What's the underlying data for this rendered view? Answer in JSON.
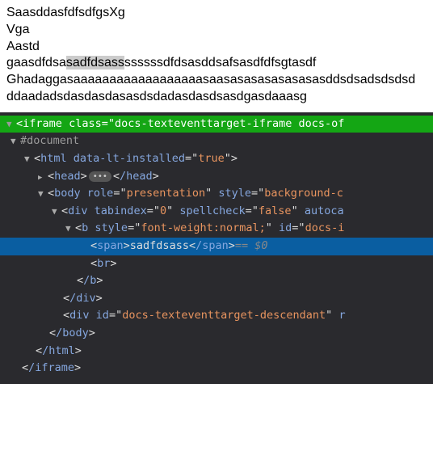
{
  "document": {
    "lines": [
      {
        "pre": "SaasddasfdfsdfgsXg",
        "sel": "",
        "post": ""
      },
      {
        "pre": "Vga",
        "sel": "",
        "post": ""
      },
      {
        "pre": "Aastd",
        "sel": "",
        "post": ""
      },
      {
        "pre": "gaasdfdsa",
        "sel": "sadfdsass",
        "post": "ssssssdfdsasddsafsasdfdfsgtasdf"
      },
      {
        "pre": "Ghadaggasaaaaaaaaaaaaaaaaaasaasasasasasasasasddsdsadsdsdsd",
        "sel": "",
        "post": ""
      },
      {
        "pre": "ddaadadsdasdasdasasdsdadasdasdsasdgasdaaasg",
        "sel": "",
        "post": ""
      }
    ]
  },
  "dom": {
    "iframe_tag": "iframe",
    "iframe_class_attr": "class",
    "iframe_class_val": "docs-texteventtarget-iframe docs-of",
    "doctype": "#document",
    "html_tag": "html",
    "html_attr": "data-lt-installed",
    "html_val": "true",
    "head_tag": "head",
    "head_close": "/head",
    "body_tag": "body",
    "body_role_attr": "role",
    "body_role_val": "presentation",
    "body_style_attr": "style",
    "body_style_val": "background-c",
    "div_tag": "div",
    "div_tab_attr": "tabindex",
    "div_tab_val": "0",
    "div_spell_attr": "spellcheck",
    "div_spell_val": "false",
    "div_autoca": "autoca",
    "b_tag": "b",
    "b_style_attr": "style",
    "b_style_val": "font-weight:normal;",
    "b_id_attr": "id",
    "b_id_val": "docs-i",
    "span_tag": "span",
    "span_text": "sadfdsass",
    "span_close": "/span",
    "eq0": " == $0",
    "br_tag": "br",
    "b_close": "/b",
    "div_close": "/div",
    "div2_tag": "div",
    "div2_id_attr": "id",
    "div2_id_val": "docs-texteventtarget-descendant",
    "div2_r": "r",
    "body_close": "/body",
    "html_close": "/html",
    "iframe_close": "/iframe"
  }
}
